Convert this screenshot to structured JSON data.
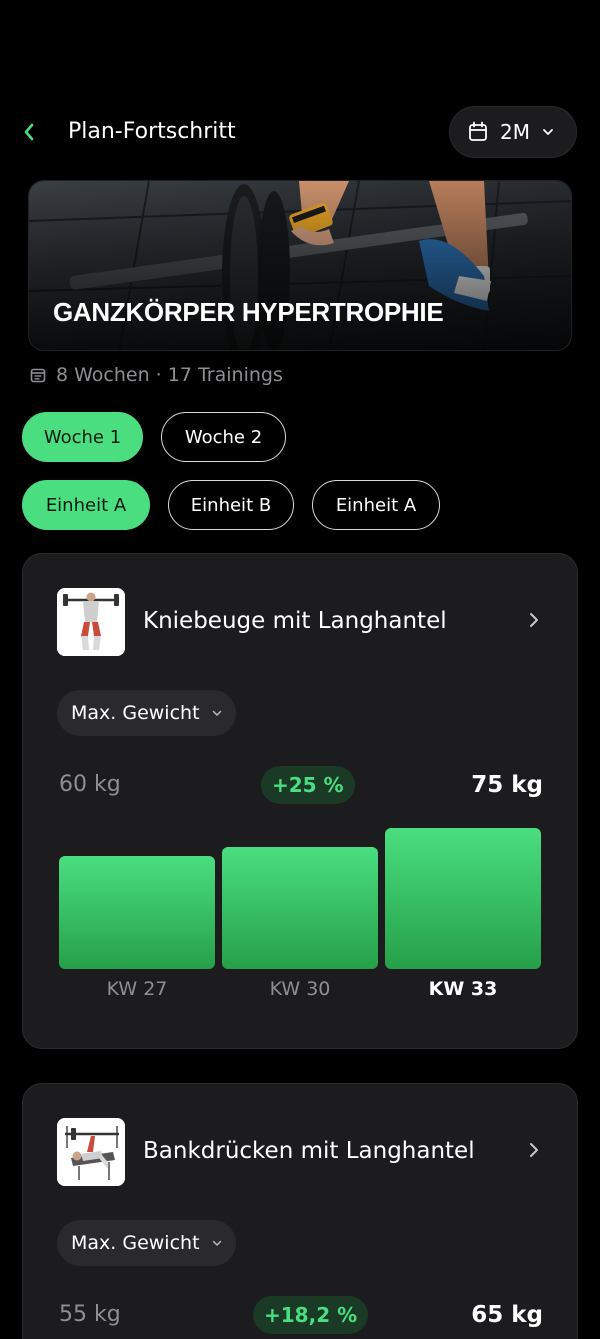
{
  "header": {
    "title": "Plan-Fortschritt",
    "range": "2M"
  },
  "plan": {
    "name": "GANZKÖRPER HYPERTROPHIE",
    "meta": "8 Wochen · 17 Trainings"
  },
  "weeks": [
    {
      "label": "Woche 1",
      "active": true
    },
    {
      "label": "Woche 2",
      "active": false
    }
  ],
  "sessions": [
    {
      "label": "Einheit A",
      "active": true
    },
    {
      "label": "Einheit B",
      "active": false
    },
    {
      "label": "Einheit A",
      "active": false
    }
  ],
  "exercises": [
    {
      "name": "Kniebeuge mit Langhantel",
      "metric": "Max. Gewicht",
      "start": "60 kg",
      "delta": "+25 %",
      "end": "75 kg",
      "chart_data": {
        "type": "bar",
        "categories": [
          "KW 27",
          "KW 30",
          "KW 33"
        ],
        "values": [
          60,
          65,
          75
        ],
        "ylim": [
          0,
          80
        ]
      }
    },
    {
      "name": "Bankdrücken mit Langhantel",
      "metric": "Max. Gewicht",
      "start": "55 kg",
      "delta": "+18,2 %",
      "end": "65 kg"
    }
  ],
  "colors": {
    "accent": "#4ade80",
    "background": "#000000",
    "card": "#1c1c1e",
    "muted": "#8e8e93"
  }
}
